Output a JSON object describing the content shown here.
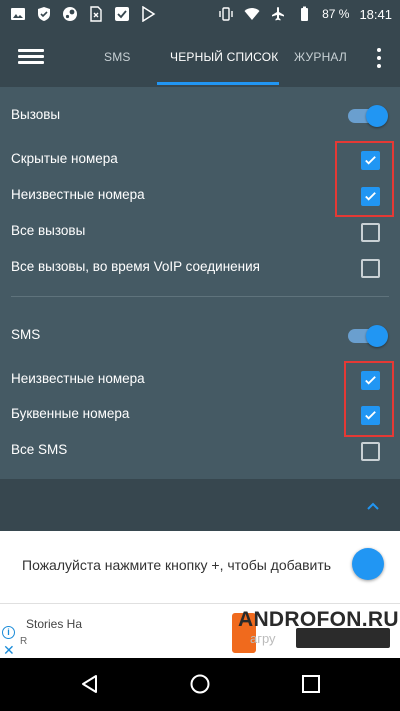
{
  "status_bar": {
    "icons_left": [
      "image-icon",
      "shield-icon",
      "steam-icon",
      "sim-icon",
      "check-icon",
      "play-store-icon"
    ],
    "icons_right": [
      "vibrate-icon",
      "wifi-icon",
      "airplane-icon",
      "battery-icon"
    ],
    "battery": "87 %",
    "time": "18:41"
  },
  "toolbar": {
    "tabs": [
      {
        "label": "SMS"
      },
      {
        "label": "ЧЕРНЫЙ СПИСОК"
      },
      {
        "label": "ЖУРНАЛ"
      }
    ]
  },
  "calls": {
    "title": "Вызовы",
    "switch_on": true,
    "items": [
      {
        "label": "Скрытые номера",
        "checked": true
      },
      {
        "label": "Неизвестные номера",
        "checked": true
      },
      {
        "label": "Все вызовы",
        "checked": false
      },
      {
        "label": "Все вызовы, во время VoIP соединения",
        "checked": false
      }
    ]
  },
  "sms": {
    "title": "SMS",
    "switch_on": true,
    "items": [
      {
        "label": "Неизвестные номера",
        "checked": true
      },
      {
        "label": "Буквенные номера",
        "checked": true
      },
      {
        "label": "Все SMS",
        "checked": false
      }
    ]
  },
  "hint": {
    "text": "Пожалуйста нажмите кнопку +, чтобы добавить"
  },
  "ad": {
    "title": "Stories На",
    "subtitle": "R",
    "gray_text": "агру"
  },
  "watermark": "ANDROFON.RU",
  "colors": {
    "toolbar": "#37474f",
    "content": "#455a64",
    "accent": "#2196f3",
    "highlight": "#e53935"
  }
}
